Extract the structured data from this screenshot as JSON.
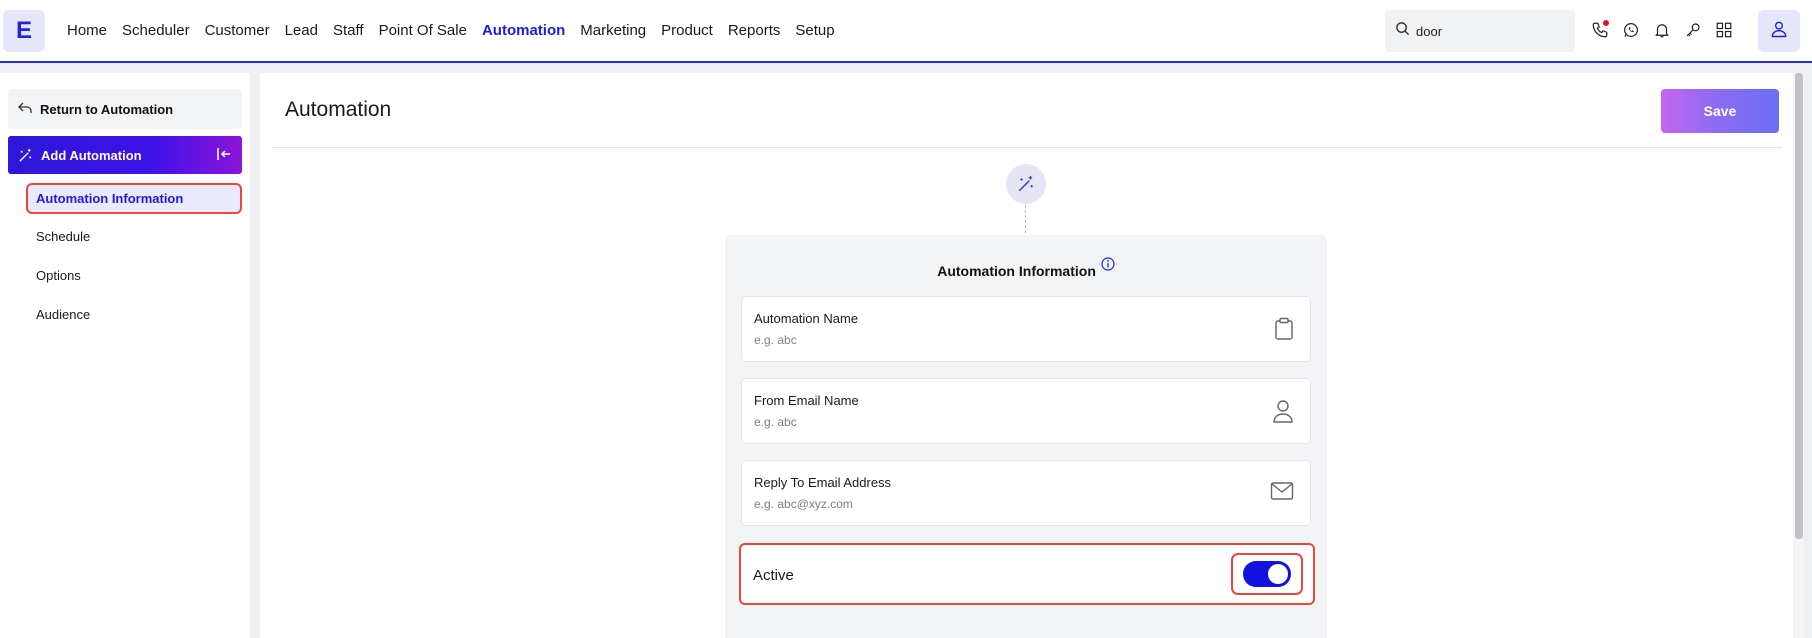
{
  "header": {
    "logo": "E",
    "nav": [
      {
        "label": "Home",
        "active": false
      },
      {
        "label": "Scheduler",
        "active": false
      },
      {
        "label": "Customer",
        "active": false
      },
      {
        "label": "Lead",
        "active": false
      },
      {
        "label": "Staff",
        "active": false
      },
      {
        "label": "Point Of Sale",
        "active": false
      },
      {
        "label": "Automation",
        "active": true
      },
      {
        "label": "Marketing",
        "active": false
      },
      {
        "label": "Product",
        "active": false
      },
      {
        "label": "Reports",
        "active": false
      },
      {
        "label": "Setup",
        "active": false
      }
    ],
    "search_value": "door",
    "icons": [
      "phone-icon",
      "whatsapp-icon",
      "bell-icon",
      "key-icon",
      "apps-grid-icon",
      "user-icon"
    ]
  },
  "sidebar": {
    "return_label": "Return to Automation",
    "section_label": "Add Automation",
    "items": [
      {
        "label": "Automation Information",
        "selected": true
      },
      {
        "label": "Schedule",
        "selected": false
      },
      {
        "label": "Options",
        "selected": false
      },
      {
        "label": "Audience",
        "selected": false
      }
    ]
  },
  "main": {
    "title": "Automation",
    "save_label": "Save",
    "card_title": "Automation Information",
    "fields": [
      {
        "label": "Automation Name",
        "placeholder": "e.g. abc",
        "icon": "clipboard-icon"
      },
      {
        "label": "From Email Name",
        "placeholder": "e.g. abc",
        "icon": "person-icon"
      },
      {
        "label": "Reply To Email Address",
        "placeholder": "e.g. abc@xyz.com",
        "icon": "mail-icon"
      }
    ],
    "active_label": "Active",
    "active_on": true
  },
  "colors": {
    "accent": "#1d1dd6",
    "highlight": "#e8483b",
    "toggle_on": "#1212e0"
  }
}
